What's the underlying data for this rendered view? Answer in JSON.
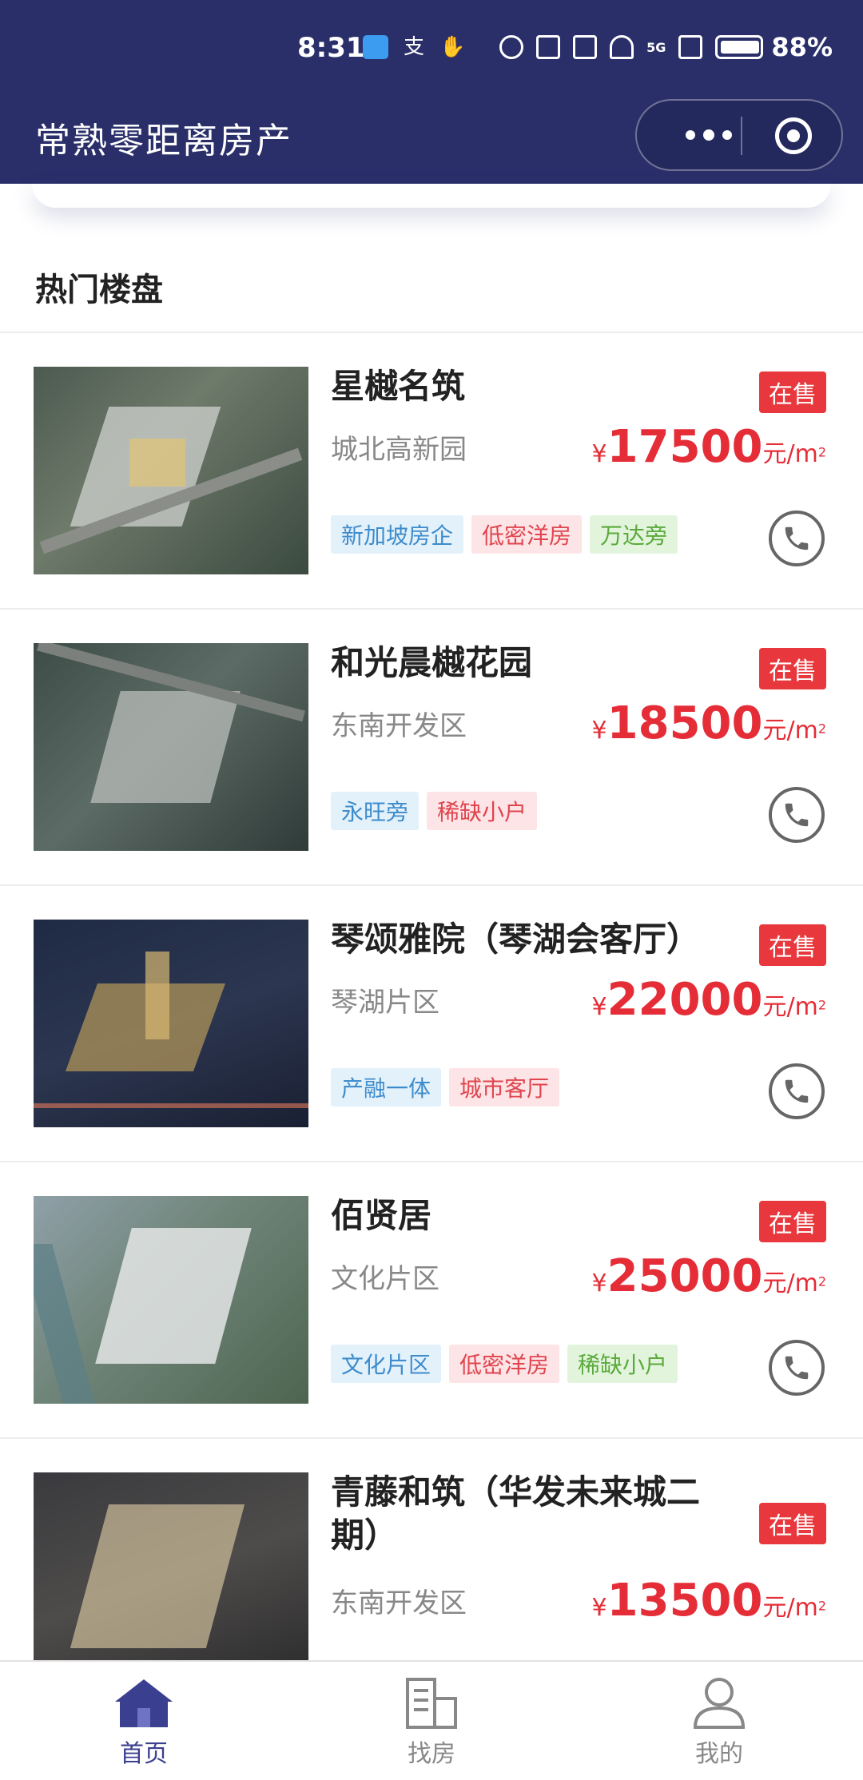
{
  "status_bar": {
    "time": "8:31",
    "battery": "88%",
    "signal_label": "5G"
  },
  "header": {
    "title": "常熟零距离房产",
    "more_icon": "more-dots-icon",
    "close_icon": "target-icon"
  },
  "section": {
    "title": "热门楼盘"
  },
  "listings": [
    {
      "name": "星樾名筑",
      "district": "城北高新园",
      "status": "在售",
      "price_symbol": "¥",
      "price": "17500",
      "unit": "元/m",
      "unit_sup": "2",
      "tags": [
        {
          "text": "新加坡房企",
          "color": "blue"
        },
        {
          "text": "低密洋房",
          "color": "red"
        },
        {
          "text": "万达旁",
          "color": "green"
        }
      ]
    },
    {
      "name": "和光晨樾花园",
      "district": "东南开发区",
      "status": "在售",
      "price_symbol": "¥",
      "price": "18500",
      "unit": "元/m",
      "unit_sup": "2",
      "tags": [
        {
          "text": "永旺旁",
          "color": "blue"
        },
        {
          "text": "稀缺小户",
          "color": "red"
        }
      ]
    },
    {
      "name": "琴颂雅院（琴湖会客厅）",
      "district": "琴湖片区",
      "status": "在售",
      "price_symbol": "¥",
      "price": "22000",
      "unit": "元/m",
      "unit_sup": "2",
      "tags": [
        {
          "text": "产融一体",
          "color": "blue"
        },
        {
          "text": "城市客厅",
          "color": "red"
        }
      ]
    },
    {
      "name": "佰贤居",
      "district": "文化片区",
      "status": "在售",
      "price_symbol": "¥",
      "price": "25000",
      "unit": "元/m",
      "unit_sup": "2",
      "tags": [
        {
          "text": "文化片区",
          "color": "blue"
        },
        {
          "text": "低密洋房",
          "color": "red"
        },
        {
          "text": "稀缺小户",
          "color": "green"
        }
      ]
    },
    {
      "name": "青藤和筑（华发未来城二期）",
      "district": "东南开发区",
      "status": "在售",
      "price_symbol": "¥",
      "price": "13500",
      "unit": "元/m",
      "unit_sup": "2",
      "tags": []
    }
  ],
  "tabbar": {
    "tabs": [
      {
        "label": "首页",
        "icon": "home-icon",
        "active": true
      },
      {
        "label": "找房",
        "icon": "building-icon",
        "active": false
      },
      {
        "label": "我的",
        "icon": "user-icon",
        "active": false
      }
    ]
  },
  "colors": {
    "nav_bg": "#2a2f6a",
    "price_red": "#e52d37",
    "badge_red": "#e8383d",
    "tab_active": "#3b3f8f"
  }
}
